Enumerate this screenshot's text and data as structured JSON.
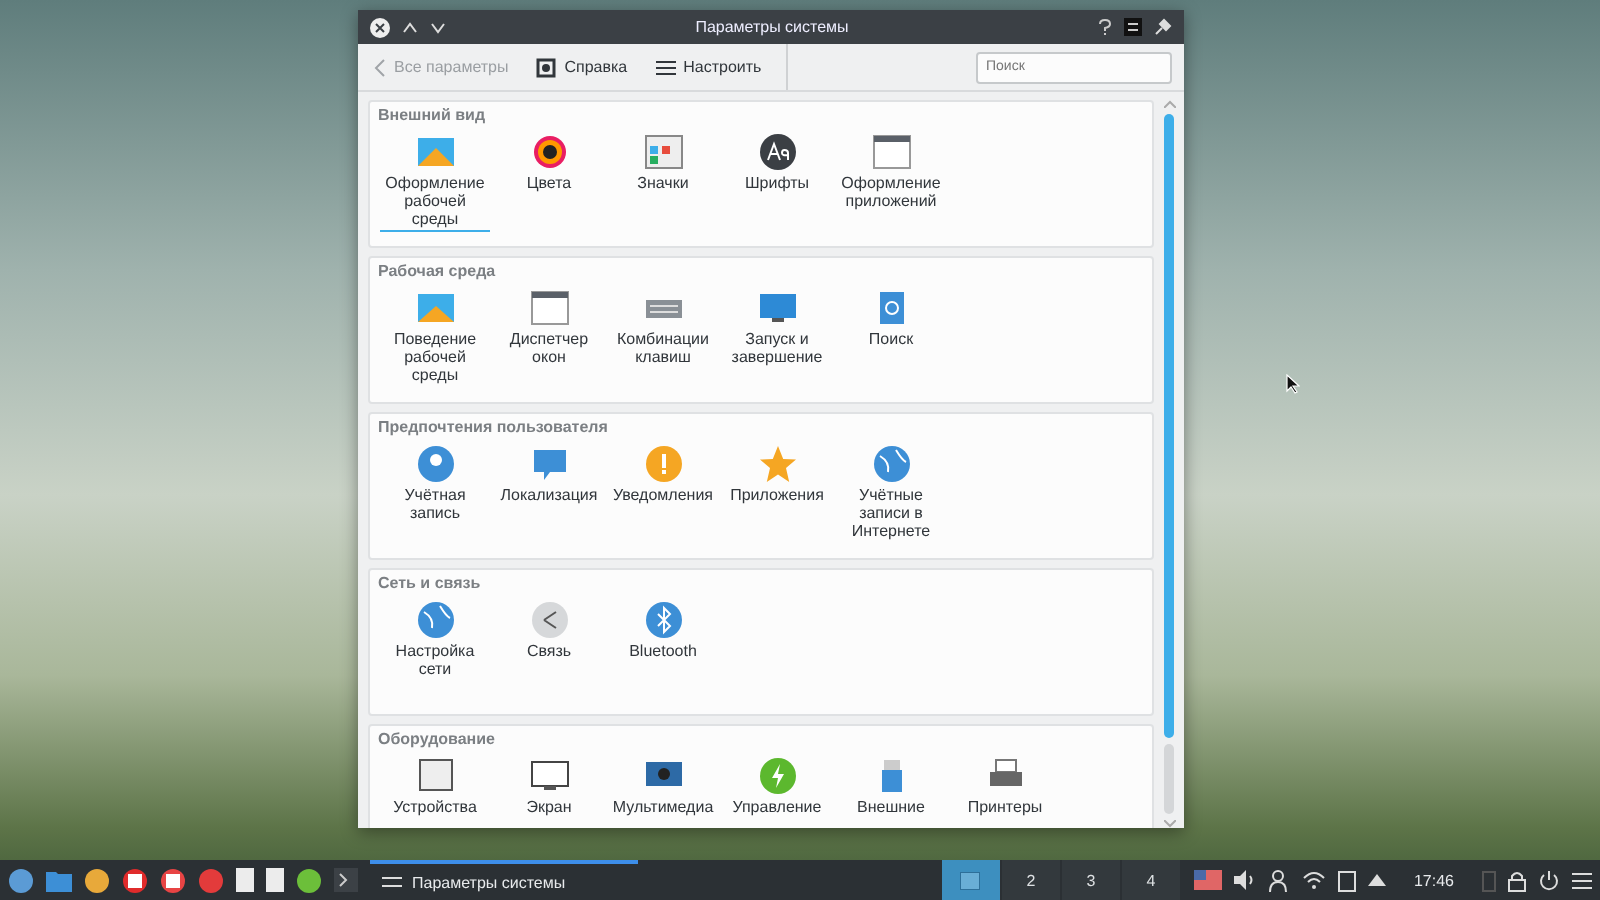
{
  "window": {
    "title": "Параметры системы"
  },
  "toolbar": {
    "back": {
      "label": "Все параметры",
      "disabled": true
    },
    "buttons": [
      "Справка",
      "Настроить"
    ],
    "search": {
      "placeholder": "Поиск"
    }
  },
  "sections": [
    {
      "title": "Внешний вид",
      "items": [
        {
          "label": "Оформление рабочей среды",
          "selected": true
        },
        {
          "label": "Цвета",
          "selected": false
        },
        {
          "label": "Значки",
          "selected": false
        },
        {
          "label": "Шрифты",
          "selected": false
        },
        {
          "label": "Оформление приложений",
          "selected": false
        }
      ]
    },
    {
      "title": "Рабочая среда",
      "items": [
        {
          "label": "Поведение рабочей среды",
          "selected": false
        },
        {
          "label": "Диспетчер окон",
          "selected": false
        },
        {
          "label": "Комбинации клавиш",
          "selected": false
        },
        {
          "label": "Запуск и завершение",
          "selected": false
        },
        {
          "label": "Поиск",
          "selected": false
        }
      ]
    },
    {
      "title": "Предпочтения пользователя",
      "items": [
        {
          "label": "Учётная запись",
          "selected": false
        },
        {
          "label": "Локализация",
          "selected": false
        },
        {
          "label": "Уведомления",
          "selected": false
        },
        {
          "label": "Приложения",
          "selected": false
        },
        {
          "label": "Учётные записи в Интернете",
          "selected": false
        }
      ]
    },
    {
      "title": "Сеть и связь",
      "items": [
        {
          "label": "Настройка сети",
          "selected": false
        },
        {
          "label": "Связь",
          "selected": false
        },
        {
          "label": "Bluetooth",
          "selected": false
        }
      ]
    },
    {
      "title": "Оборудование",
      "items": [
        {
          "label": "Устройства",
          "selected": false
        },
        {
          "label": "Экран",
          "selected": false
        },
        {
          "label": "Мультимедиа",
          "selected": false
        },
        {
          "label": "Управление",
          "selected": false
        },
        {
          "label": "Внешние",
          "selected": false
        },
        {
          "label": "Принтеры",
          "selected": false
        }
      ]
    }
  ],
  "taskbar": {
    "task": {
      "label": "Параметры системы",
      "selected": true
    },
    "desktops": [
      {
        "selected": true
      },
      {
        "label": "2",
        "selected": false
      },
      {
        "label": "3",
        "selected": false
      },
      {
        "label": "4",
        "selected": false
      }
    ],
    "clock": "17:46"
  }
}
